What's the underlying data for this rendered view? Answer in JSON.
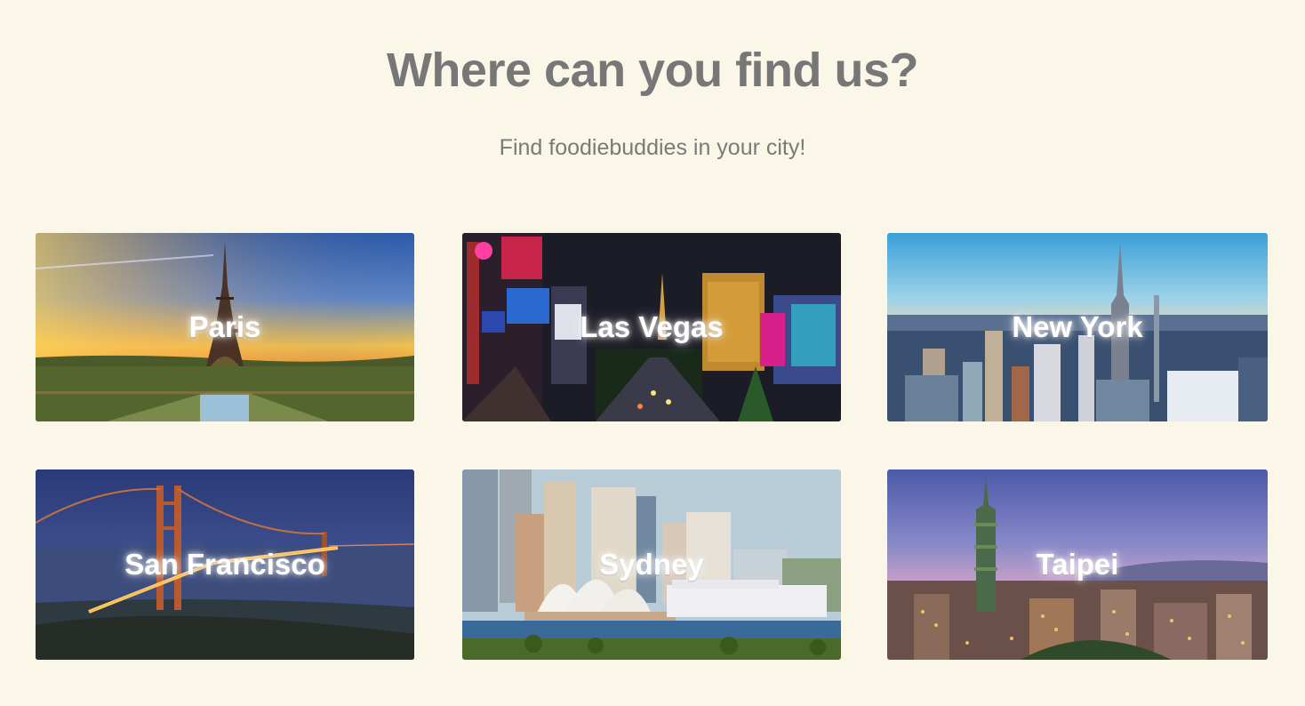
{
  "header": {
    "title": "Where can you find us?",
    "subtitle": "Find foodiebuddies in your city!"
  },
  "cities": [
    {
      "name": "Paris"
    },
    {
      "name": "Las Vegas"
    },
    {
      "name": "New York"
    },
    {
      "name": "San Francisco"
    },
    {
      "name": "Sydney"
    },
    {
      "name": "Taipei"
    }
  ],
  "colors": {
    "background": "#faf6e8",
    "heading": "#777777",
    "label": "#ffffff"
  }
}
